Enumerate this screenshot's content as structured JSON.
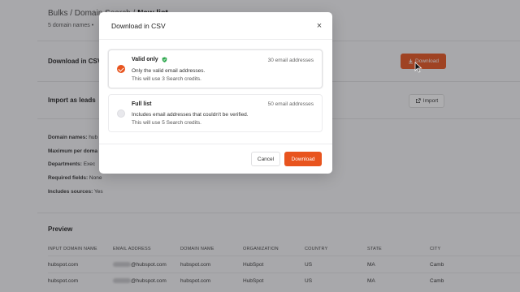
{
  "page": {
    "breadcrumb": {
      "root": "Bulks",
      "middle": "Domain Search",
      "current": "New list"
    },
    "subline": "5 domain names •",
    "download_csv_title": "Download in CSV",
    "download_button_label": "Download",
    "import_title": "Import as leads",
    "import_button_label": "Import",
    "info": [
      {
        "label": "Domain names:",
        "value": " hub"
      },
      {
        "label": "Maximum per doma",
        "value": ""
      },
      {
        "label": "Departments:",
        "value": " Exec"
      },
      {
        "label": "Required fields:",
        "value": " None"
      },
      {
        "label": "Includes sources:",
        "value": " Yes"
      }
    ],
    "preview_title": "Preview",
    "table": {
      "headers": [
        "INPUT DOMAIN NAME",
        "EMAIL ADDRESS",
        "DOMAIN NAME",
        "ORGANIZATION",
        "COUNTRY",
        "STATE",
        "CITY"
      ],
      "rows": [
        [
          "hubspot.com",
          "@hubspot.com",
          "hubspot.com",
          "HubSpot",
          "US",
          "MA",
          "Camb"
        ],
        [
          "hubspot.com",
          "@hubspot.com",
          "hubspot.com",
          "HubSpot",
          "US",
          "MA",
          "Camb"
        ]
      ]
    }
  },
  "modal": {
    "title": "Download in CSV",
    "close_glyph": "×",
    "options": [
      {
        "title": "Valid only",
        "count": "30 email addresses",
        "description": "Only the valid email addresses.",
        "credits": "This will use 3 Search credits.",
        "selected": true
      },
      {
        "title": "Full list",
        "count": "50 email addresses",
        "description": "Includes email addresses that couldn't be verified.",
        "credits": "This will use 5 Search credits.",
        "selected": false
      }
    ],
    "cancel_label": "Cancel",
    "download_label": "Download"
  },
  "colors": {
    "accent": "#e8541e",
    "verified": "#2fa84f"
  },
  "icons": {
    "close": "close-icon",
    "verified": "verified-shield-icon",
    "download": "download-icon",
    "import": "import-icon",
    "cursor": "mouse-cursor-icon"
  }
}
